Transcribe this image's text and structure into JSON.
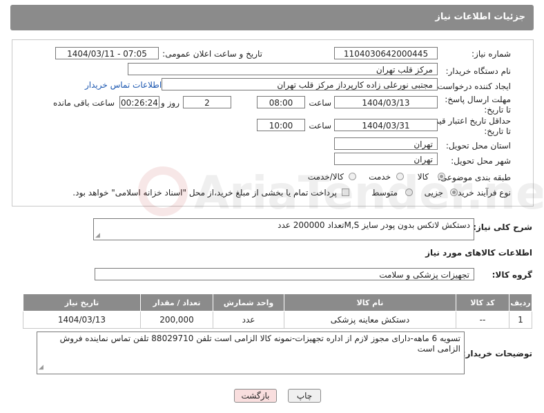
{
  "header": {
    "title": "جزئیات اطلاعات نیاز"
  },
  "form": {
    "need_number": {
      "label": "شماره نیاز:",
      "value": "1104030642000445"
    },
    "announce_datetime": {
      "label": "تاریخ و ساعت اعلان عمومی:",
      "value": "1404/03/11 - 07:05"
    },
    "buyer_org": {
      "label": "نام دستگاه خریدار:",
      "value": "مرکز قلب تهران"
    },
    "requester": {
      "label": "ایجاد کننده درخواست:",
      "value": "مجتبی نورعلی زاده کارپرداز مرکز قلب تهران"
    },
    "buyer_contact_link": "اطلاعات تماس خریدار",
    "response_deadline": {
      "label": "مهلت ارسال پاسخ: تا تاریخ:",
      "date": "1404/03/13",
      "time_label": "ساعت",
      "time": "08:00",
      "days": "2",
      "days_label": "روز و",
      "remaining": "00:26:24",
      "remaining_label": "ساعت باقی مانده"
    },
    "price_validity": {
      "label": "حداقل تاریخ اعتبار قیمت: تا تاریخ:",
      "date": "1404/03/31",
      "time_label": "ساعت",
      "time": "10:00"
    },
    "delivery_province": {
      "label": "استان محل تحویل:",
      "value": "تهران"
    },
    "delivery_city": {
      "label": "شهر محل تحویل:",
      "value": "تهران"
    },
    "category": {
      "label": "طبقه بندی موضوعی:",
      "options": [
        "کالا",
        "خدمت",
        "کالا/خدمت"
      ],
      "selected": "کالا"
    },
    "purchase_process": {
      "label": "نوع فرآیند خرید :",
      "options": [
        "جزیی",
        "متوسط"
      ],
      "selected": "جزیی",
      "payment_note": "پرداخت تمام یا بخشی از مبلغ خرید،از محل \"اسناد خزانه اسلامی\" خواهد بود."
    }
  },
  "description": {
    "label": "شرح کلی نیاز:",
    "value": "دستکش لاتکس بدون پودر سایز M,Sتعداد 200000 عدد"
  },
  "goods_section": {
    "title": "اطلاعات کالاهای مورد نیاز"
  },
  "goods_group": {
    "label": "گروه کالا:",
    "value": "تجهیزات پزشکی و سلامت"
  },
  "items_table": {
    "headers": [
      "ردیف",
      "کد کالا",
      "نام کالا",
      "واحد شمارش",
      "تعداد / مقدار",
      "تاریخ نیاز"
    ],
    "rows": [
      [
        "1",
        "--",
        "دستکش معاینه پزشکی",
        "عدد",
        "200,000",
        "1404/03/13"
      ]
    ]
  },
  "buyer_notes": {
    "label": "توضیحات خریدار:",
    "value": "تسویه 6 ماهه-دارای مجوز لازم از اداره تجهیزات-نمونه کالا الزامی است تلفن 88029710 تلفن تماس نماینده فروش الزامی است"
  },
  "buttons": {
    "print": "چاپ",
    "back": "بازگشت"
  },
  "watermark_text": "AriaTender.neT",
  "colors": {
    "header_bg": "#8b8b8b",
    "link": "#1a56b0",
    "back_button_bg": "#f9dede"
  }
}
